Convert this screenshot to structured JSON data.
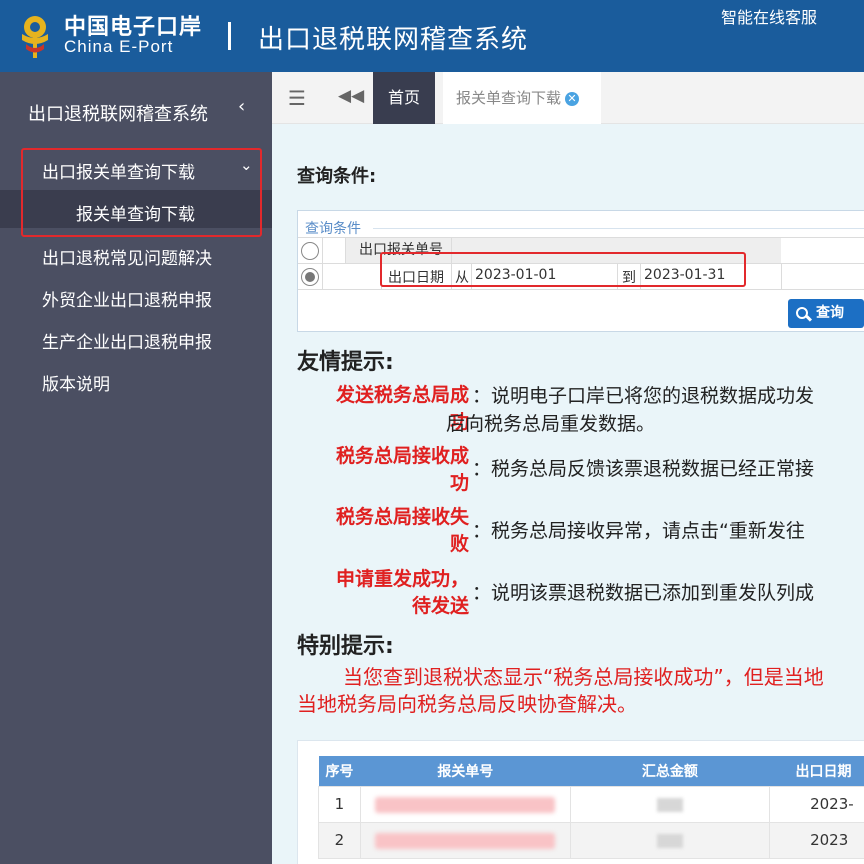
{
  "header": {
    "logo_cn": "中国电子口岸",
    "logo_en": "China E-Port",
    "system_title": "出口退税联网稽查系统",
    "support_link": "智能在线客服",
    "colors": {
      "header_bg": "#1a5c9c",
      "sidebar_bg": "#4b4f62",
      "accent_red": "#e02020",
      "button_blue": "#1c6fc4"
    }
  },
  "sidebar": {
    "title": "出口退税联网稽查系统",
    "collapse_icon": "‹",
    "group_label": "出口报关单查询下载",
    "group_icon": "chevron-down",
    "sub_item": "报关单查询下载",
    "items": [
      "出口退税常见问题解决",
      "外贸企业出口退税申报",
      "生产企业出口退税申报",
      "版本说明"
    ]
  },
  "tabs": {
    "home": "首页",
    "active": "报关单查询下载"
  },
  "query": {
    "heading": "查询条件:",
    "legend": "查询条件",
    "row1_label": "出口报关单号",
    "row2_label": "出口日期",
    "from_label": "从",
    "from_value": "2023-01-01",
    "to_label": "到",
    "to_value": "2023-01-31",
    "selected_option": "出口日期",
    "button_label": "查询"
  },
  "tips": {
    "heading": "友情提示:",
    "items": [
      {
        "term_line1": "发送税务总局成",
        "term_line2": "功",
        "desc_line1": "：说明电子口岸已将您的退税数据成功发",
        "desc_line2": "后向税务总局重发数据。"
      },
      {
        "term_line1": "税务总局接收成",
        "term_line2": "功",
        "desc_line1": "：税务总局反馈该票退税数据已经正常接"
      },
      {
        "term_line1": "税务总局接收失",
        "term_line2": "败",
        "desc_line1": "：税务总局接收异常，请点击“重新发往"
      },
      {
        "term_line1": "申请重发成功，",
        "term_line2": "待发送",
        "desc_line1": "：说明该票退税数据已添加到重发队列成"
      }
    ]
  },
  "special": {
    "heading": "特别提示:",
    "line1": "当您查到退税状态显示“税务总局接收成功”，但是当地",
    "line2": "当地税务局向税务总局反映协查解决。"
  },
  "results": {
    "columns": [
      "序号",
      "报关单号",
      "汇总金额",
      "出口日期"
    ],
    "rows": [
      {
        "index": "1",
        "date": "2023-"
      },
      {
        "index": "2",
        "date": "2023"
      }
    ]
  }
}
